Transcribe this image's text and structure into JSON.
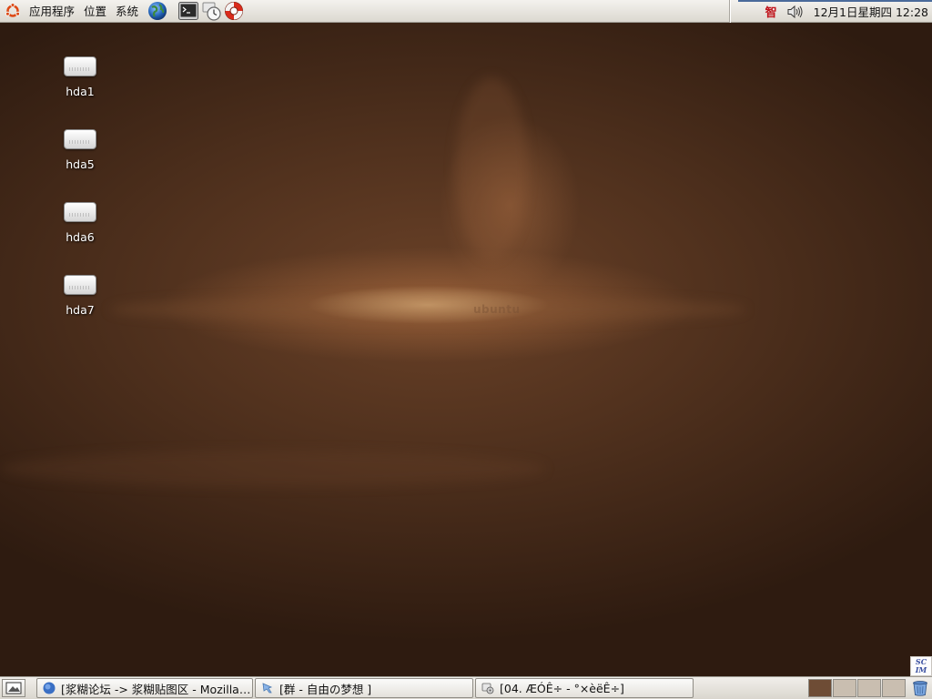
{
  "top_panel": {
    "menus": [
      "应用程序",
      "位置",
      "系统"
    ],
    "launchers": [
      "web-browser-icon",
      "terminal-icon",
      "clock-app-icon",
      "help-lifebuoy-icon"
    ],
    "tray": {
      "input_method": "智",
      "volume_icon": "speaker-icon",
      "clock": "12月1日星期四 12:28"
    }
  },
  "desktop": {
    "watermark": "ubuntu",
    "icons": [
      {
        "label": "hda1",
        "icon": "hard-drive-icon"
      },
      {
        "label": "hda5",
        "icon": "hard-drive-icon"
      },
      {
        "label": "hda6",
        "icon": "hard-drive-icon"
      },
      {
        "label": "hda7",
        "icon": "hard-drive-icon"
      }
    ]
  },
  "scim": {
    "line1": "SC",
    "line2": "IM"
  },
  "bottom_panel": {
    "tasks": [
      {
        "label": "[浆糊论坛 -> 浆糊贴图区 - Mozilla Firefox]",
        "icon": "firefox-icon"
      },
      {
        "label": "[群 - 自由の梦想 ]",
        "icon": "chat-icon"
      },
      {
        "label": "[04. ÆÓÊ÷ - °×èëÊ÷]",
        "icon": "media-player-icon"
      }
    ],
    "workspaces": [
      {
        "active": true,
        "color": "#6e4c35"
      },
      {
        "active": false,
        "color": "#c9beb0"
      },
      {
        "active": false,
        "color": "#c9beb0"
      },
      {
        "active": false,
        "color": "#c9beb0"
      }
    ],
    "trash_icon": "trash-icon"
  },
  "colors": {
    "panel_bg": "#e6e3dd",
    "desktop_bg": "#3a2417",
    "accent_orange": "#dd4814"
  }
}
